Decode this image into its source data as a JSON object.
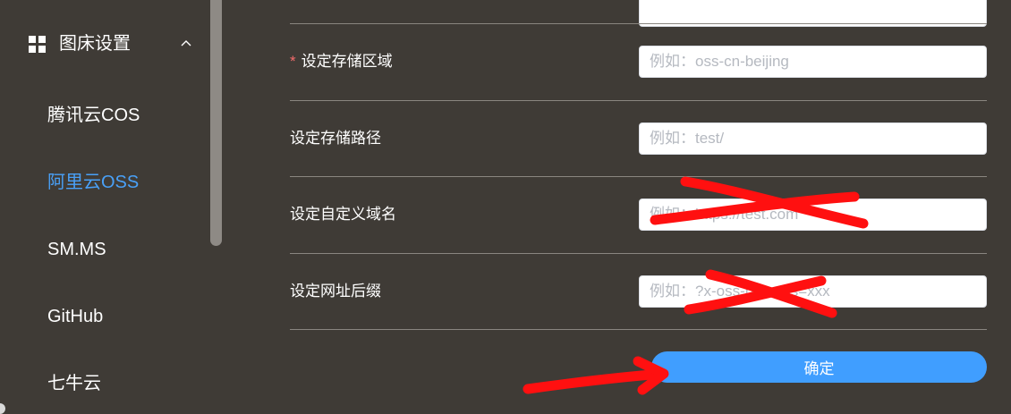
{
  "sidebar": {
    "group": {
      "label": "图床设置",
      "icon": "grid-icon",
      "expanded": true
    },
    "items": [
      {
        "label": "腾讯云COS",
        "active": false
      },
      {
        "label": "阿里云OSS",
        "active": true
      },
      {
        "label": "SM.MS",
        "active": false
      },
      {
        "label": "GitHub",
        "active": false
      },
      {
        "label": "七牛云",
        "active": false
      }
    ]
  },
  "form": {
    "region": {
      "label": "设定存储区域",
      "required": true,
      "value": "",
      "placeholder": "例如：oss-cn-beijing"
    },
    "path": {
      "label": "设定存储路径",
      "required": false,
      "value": "",
      "placeholder": "例如：test/"
    },
    "domain": {
      "label": "设定自定义域名",
      "required": false,
      "value": "",
      "placeholder": "例如：https://test.com"
    },
    "suffix": {
      "label": "设定网址后缀",
      "required": false,
      "value": "",
      "placeholder": "例如：?x-oss-process=xxx"
    },
    "confirm_label": "确定"
  },
  "colors": {
    "background": "#3f3b36",
    "accent": "#409eff",
    "active_text": "#49a0f7",
    "required_star": "#f56c6c",
    "annotation": "#ff1010"
  }
}
